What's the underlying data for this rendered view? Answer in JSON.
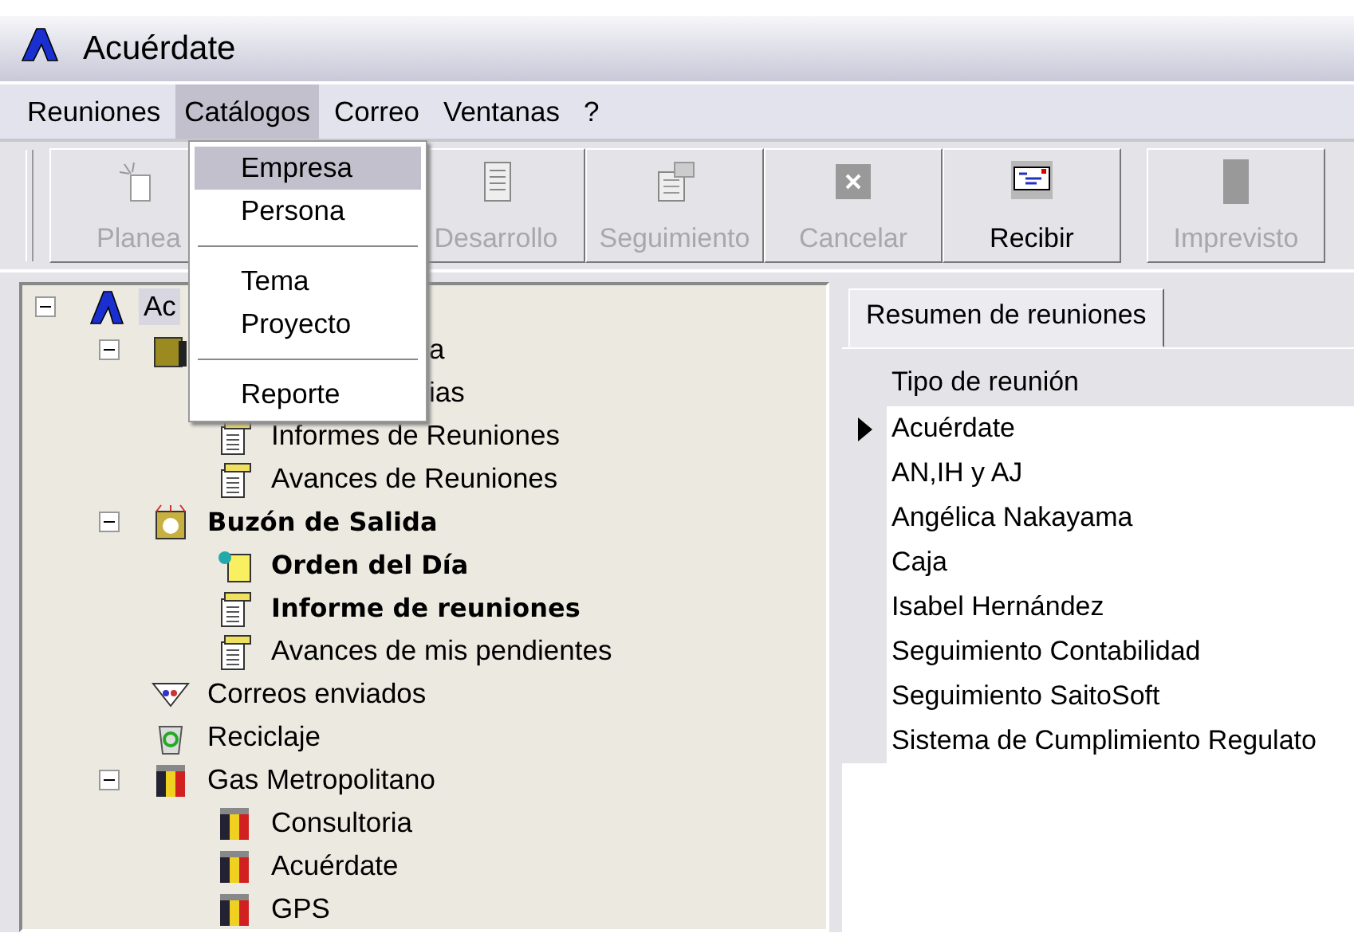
{
  "window": {
    "title": "Acuérdate"
  },
  "menu_bar": [
    {
      "label": "Reuniones",
      "selected": false
    },
    {
      "label": "Catálogos",
      "selected": true
    },
    {
      "label": "Correo",
      "selected": false
    },
    {
      "label": "Ventanas",
      "selected": false
    },
    {
      "label": "?",
      "selected": false
    }
  ],
  "dropdown": [
    {
      "kind": "item",
      "label": "Empresa",
      "selected": true
    },
    {
      "kind": "item",
      "label": "Persona",
      "selected": false
    },
    {
      "kind": "separator"
    },
    {
      "kind": "item",
      "label": "Tema",
      "selected": false
    },
    {
      "kind": "item",
      "label": "Proyecto",
      "selected": false
    },
    {
      "kind": "separator"
    },
    {
      "kind": "item",
      "label": "Reporte",
      "selected": false
    }
  ],
  "toolbar": [
    {
      "kind": "new",
      "label": "Planea",
      "disabled": true
    },
    {
      "kind": "list",
      "label": "Desarrollo",
      "disabled": true
    },
    {
      "kind": "track",
      "label": "Seguimiento",
      "disabled": true
    },
    {
      "kind": "cancel",
      "label": "Cancelar",
      "disabled": true
    },
    {
      "kind": "mail",
      "label": "Recibir",
      "disabled": false
    },
    {
      "kind": "blank",
      "label": "Imprevisto",
      "disabled": true
    }
  ],
  "tree": [
    {
      "kind": "app",
      "label": "Ac",
      "selected": true,
      "expanded": true,
      "children": [
        {
          "kind": "folder",
          "label": "a",
          "covered": true,
          "selected": false,
          "expanded": true,
          "children": [
            {
              "kind": "none",
              "label": "ias",
              "covered": true,
              "selected": false
            },
            {
              "kind": "report",
              "label": "Informes de Reuniones",
              "selected": false
            },
            {
              "kind": "report",
              "label": "Avances de Reuniones",
              "selected": false
            }
          ]
        },
        {
          "kind": "outbox",
          "label": "Buzón de Salida",
          "selected": false,
          "bold": true,
          "expanded": true,
          "children": [
            {
              "kind": "agenda",
              "label": "Orden del Día",
              "selected": false,
              "bold": true
            },
            {
              "kind": "report",
              "label": "Informe de reuniones",
              "selected": false,
              "bold": true
            },
            {
              "kind": "report",
              "label": "Avances de mis pendientes",
              "selected": false
            }
          ]
        },
        {
          "kind": "sent",
          "label": "Correos enviados",
          "selected": false
        },
        {
          "kind": "recycle",
          "label": "Reciclaje",
          "selected": false
        },
        {
          "kind": "company",
          "label": "Gas Metropolitano",
          "selected": false,
          "expanded": true,
          "children": [
            {
              "kind": "company",
              "label": "Consultoria",
              "selected": false
            },
            {
              "kind": "company",
              "label": "Acuérdate",
              "selected": false
            },
            {
              "kind": "company",
              "label": "GPS",
              "selected": false
            }
          ]
        }
      ]
    }
  ],
  "tabs": [
    {
      "label": "Resumen de reuniones",
      "selected": true
    }
  ],
  "grid": {
    "columns": [
      "Tipo de reunión"
    ],
    "rows": [
      {
        "cell": "Acuérdate",
        "selected": true
      },
      {
        "cell": "AN,IH y AJ",
        "selected": false
      },
      {
        "cell": "Angélica Nakayama",
        "selected": false
      },
      {
        "cell": "Caja",
        "selected": false
      },
      {
        "cell": "Isabel Hernández",
        "selected": false
      },
      {
        "cell": "Seguimiento Contabilidad",
        "selected": false
      },
      {
        "cell": "Seguimiento SaitoSoft",
        "selected": false
      },
      {
        "cell": "Sistema de Cumplimiento Regulato",
        "selected": false
      }
    ]
  }
}
